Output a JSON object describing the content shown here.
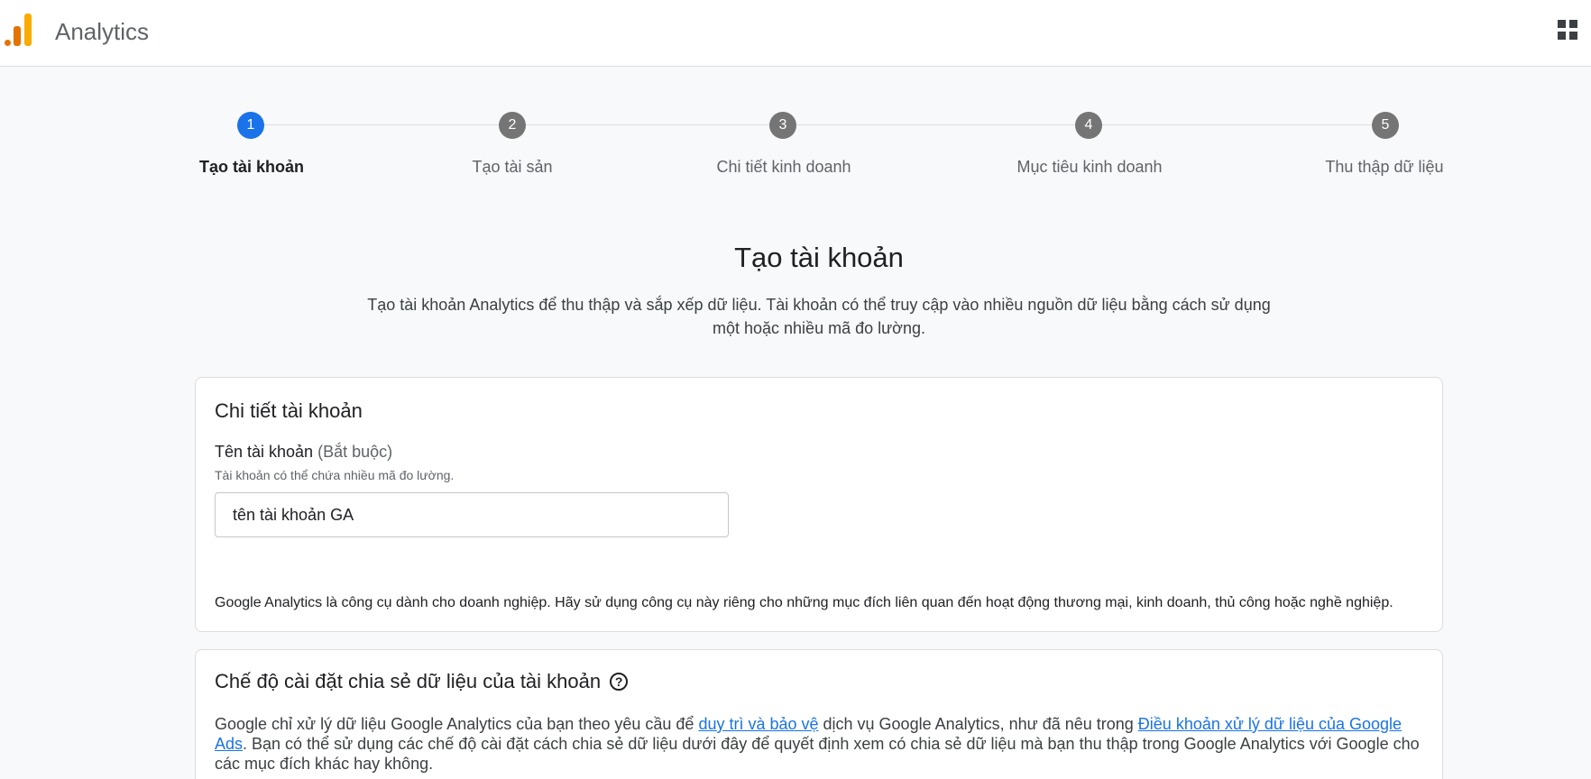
{
  "header": {
    "title": "Analytics",
    "logo_icon": "analytics-logo",
    "apps_icon": "apps-grid-icon"
  },
  "stepper": {
    "steps": [
      {
        "number": "1",
        "label": "Tạo tài khoản"
      },
      {
        "number": "2",
        "label": "Tạo tài sản"
      },
      {
        "number": "3",
        "label": "Chi tiết kinh doanh"
      },
      {
        "number": "4",
        "label": "Mục tiêu kinh doanh"
      },
      {
        "number": "5",
        "label": "Thu thập dữ liệu"
      }
    ],
    "current_step": 1
  },
  "main": {
    "title": "Tạo tài khoản",
    "subtitle": "Tạo tài khoản Analytics để thu thập và sắp xếp dữ liệu. Tài khoản có thể truy cập vào nhiều nguồn dữ liệu bằng cách sử dụng một hoặc nhiều mã đo lường."
  },
  "account_details": {
    "title": "Chi tiết tài khoản",
    "field_label": "Tên tài khoản",
    "field_required": "(Bắt buộc)",
    "field_hint": "Tài khoản có thể chứa nhiều mã đo lường.",
    "field_value": "tên tài khoản GA",
    "notice": "Google Analytics là công cụ dành cho doanh nghiệp. Hãy sử dụng công cụ này riêng cho những mục đích liên quan đến hoạt động thương mại, kinh doanh, thủ công hoặc nghề nghiệp."
  },
  "data_sharing": {
    "title": "Chế độ cài đặt chia sẻ dữ liệu của tài khoản",
    "help_icon": "help-circle-icon",
    "help_glyph": "?",
    "text_before_link1": "Google chỉ xử lý dữ liệu Google Analytics của bạn theo yêu cầu để ",
    "link1": "duy trì và bảo vệ",
    "text_between_links": " dịch vụ Google Analytics, như đã nêu trong ",
    "link2": "Điều khoản xử lý dữ liệu của Google Ads",
    "text_after_link2": ". Bạn có thể sử dụng các chế độ cài đặt cách chia sẻ dữ liệu dưới đây để quyết định xem có chia sẻ dữ liệu mà bạn thu thập trong Google Analytics với Google cho các mục đích khác hay không."
  },
  "colors": {
    "accent": "#1a73e8",
    "step_inactive": "#757575",
    "logo_orange": "#e37400",
    "logo_yellow": "#f9ab00"
  }
}
